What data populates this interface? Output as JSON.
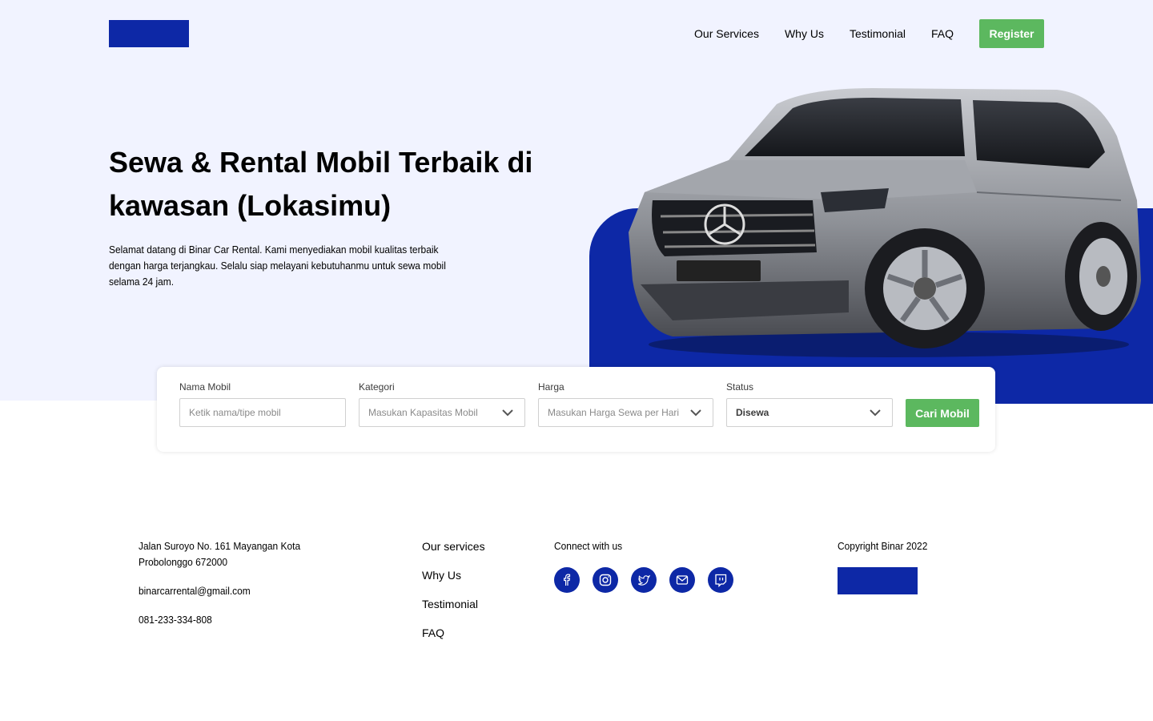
{
  "nav": {
    "items": [
      "Our Services",
      "Why Us",
      "Testimonial",
      "FAQ"
    ],
    "register_label": "Register"
  },
  "hero": {
    "title": "Sewa & Rental Mobil Terbaik di kawasan (Lokasimu)",
    "description": "Selamat datang di Binar Car Rental. Kami menyediakan mobil kualitas terbaik dengan harga terjangkau. Selalu siap melayani kebutuhanmu untuk sewa mobil selama 24 jam."
  },
  "search": {
    "nama_label": "Nama Mobil",
    "nama_placeholder": "Ketik nama/tipe mobil",
    "kategori_label": "Kategori",
    "kategori_value": "Masukan Kapasitas Mobil",
    "harga_label": "Harga",
    "harga_value": "Masukan Harga Sewa per Hari",
    "status_label": "Status",
    "status_value": "Disewa",
    "button_label": "Cari Mobil"
  },
  "footer": {
    "address": "Jalan Suroyo No. 161 Mayangan Kota Probolonggo 672000",
    "email": "binarcarrental@gmail.com",
    "phone": "081-233-334-808",
    "links": [
      "Our services",
      "Why Us",
      "Testimonial",
      "FAQ"
    ],
    "connect_title": "Connect with us",
    "socials": [
      "facebook-icon",
      "instagram-icon",
      "twitter-icon",
      "mail-icon",
      "twitch-icon"
    ],
    "copyright": "Copyright Binar 2022"
  },
  "colors": {
    "primary": "#0d28a6",
    "accent": "#5cb85f",
    "hero_bg": "#f1f3ff"
  }
}
